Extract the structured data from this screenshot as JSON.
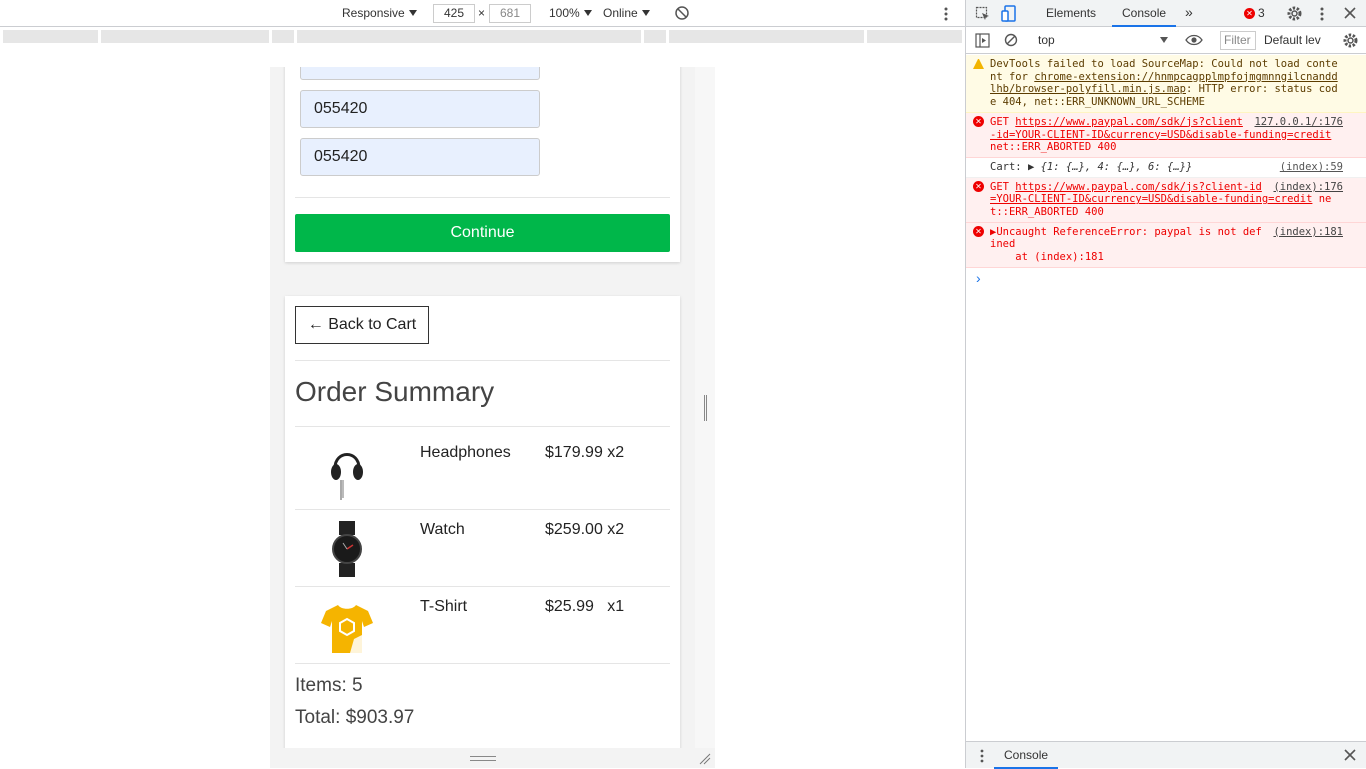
{
  "device_toolbar": {
    "device": "Responsive",
    "width": "425",
    "times": "×",
    "height": "681",
    "zoom": "100%",
    "throttle": "Online"
  },
  "form": {
    "field1_value": "055420",
    "field2_value": "055420",
    "continue_label": "Continue"
  },
  "summary": {
    "back_label": "← Back to Cart",
    "title": "Order Summary",
    "items": [
      {
        "name": "Headphones",
        "price": "$179.99 x2",
        "icon": "headphones-image"
      },
      {
        "name": "Watch",
        "price": "$259.00 x2",
        "icon": "watch-image"
      },
      {
        "name": "T-Shirt",
        "price": "$25.99   x1",
        "icon": "tshirt-image"
      }
    ],
    "items_count": "Items: 5",
    "total": "Total: $903.97"
  },
  "devtools": {
    "tabs": {
      "elements": "Elements",
      "console": "Console",
      "more": "»"
    },
    "error_count": "3",
    "context": "top",
    "filter_placeholder": "Filter",
    "levels": "Default lev",
    "messages": [
      {
        "type": "warn",
        "text_prefix": "DevTools failed to load SourceMap: Could not load content for ",
        "link": "chrome-extension://hnmpcagpplmpfojmgmnngilcnanddlhb/browser-polyfill.min.js.map",
        "text_suffix": ": HTTP error: status code 404, net::ERR_UNKNOWN_URL_SCHEME",
        "source": ""
      },
      {
        "type": "err",
        "text_prefix": "GET ",
        "link": "https://www.paypal.com/sdk/js?client-id=YOUR-CLIENT-ID&currency=USD&disable-funding=credit",
        "text_suffix": " net::ERR_ABORTED 400",
        "source": "127.0.0.1/:176"
      },
      {
        "type": "log",
        "text_prefix": "Cart: ",
        "link": "",
        "text_suffix": "▶ {1: {…}, 4: {…}, 6: {…}}",
        "source": "(index):59"
      },
      {
        "type": "err",
        "text_prefix": "GET ",
        "link": "https://www.paypal.com/sdk/js?client-id=YOUR-CLIENT-ID&currency=USD&disable-funding=credit",
        "text_suffix": " net::ERR_ABORTED 400",
        "source": "(index):176"
      },
      {
        "type": "err",
        "text_prefix": "▶Uncaught ReferenceError: paypal is not defined",
        "link": "",
        "text_suffix": "",
        "source": "(index):181",
        "extra": "    at (index):181"
      }
    ],
    "prompt": "›",
    "drawer_tab": "Console"
  },
  "colors": {
    "accent": "#1a73e8",
    "continue_green": "#00b74a",
    "error_red": "#e00",
    "warning_yellow": "#f2b400",
    "field_bg": "#e8f0fe"
  }
}
